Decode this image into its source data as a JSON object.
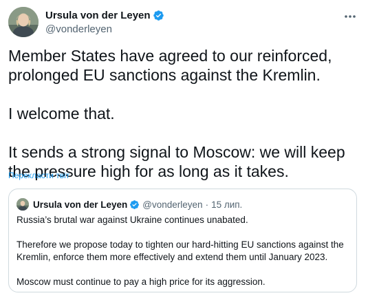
{
  "tweet": {
    "author": {
      "name": "Ursula von der Leyen",
      "handle": "@vonderleyen"
    },
    "text": {
      "p1": "Member States have agreed to our reinforced, prolonged EU sanctions against the Kremlin.",
      "p2": "I welcome that.",
      "p3": "It sends a strong signal to Moscow: we will keep the pressure high for as long as it takes."
    },
    "translate_label": "Перекласти твіт"
  },
  "quote": {
    "author": {
      "name": "Ursula von der Leyen",
      "handle": "@vonderleyen",
      "separator": "·",
      "time": "15 лип."
    },
    "text": {
      "p1": "Russia’s brutal war against Ukraine continues unabated.",
      "p2": "Therefore we propose today to tighten our hard-hitting EU sanctions against the Kremlin, enforce them more effectively and extend them until January 2023.",
      "p3": "Moscow must continue to pay a high price for its aggression."
    }
  },
  "icons": {
    "verified": "verified-badge-icon",
    "more": "more-dots-icon"
  },
  "colors": {
    "accent": "#1d9bf0",
    "text": "#0f1419",
    "secondary": "#536471",
    "border": "#cfd9de"
  }
}
